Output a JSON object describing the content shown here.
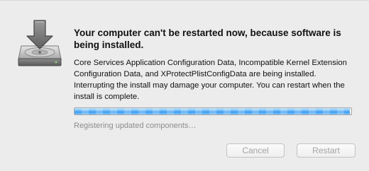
{
  "dialog": {
    "title": "Your computer can't be restarted now, because software is being installed.",
    "message": "Core Services Application Configuration Data, Incompatible Kernel Extension Configuration Data, and XProtectPlistConfigData are being installed. Interrupting the install may damage your computer. You can restart when the install is complete.",
    "progress_fraction": 0.995,
    "status": "Registering updated components…"
  },
  "buttons": {
    "cancel_label": "Cancel",
    "restart_label": "Restart",
    "enabled": false
  },
  "icons": {
    "installer": "installer-disk-icon"
  },
  "colors": {
    "progress_accent": "#4aa3f0",
    "disabled_text": "#a3a3a3"
  }
}
